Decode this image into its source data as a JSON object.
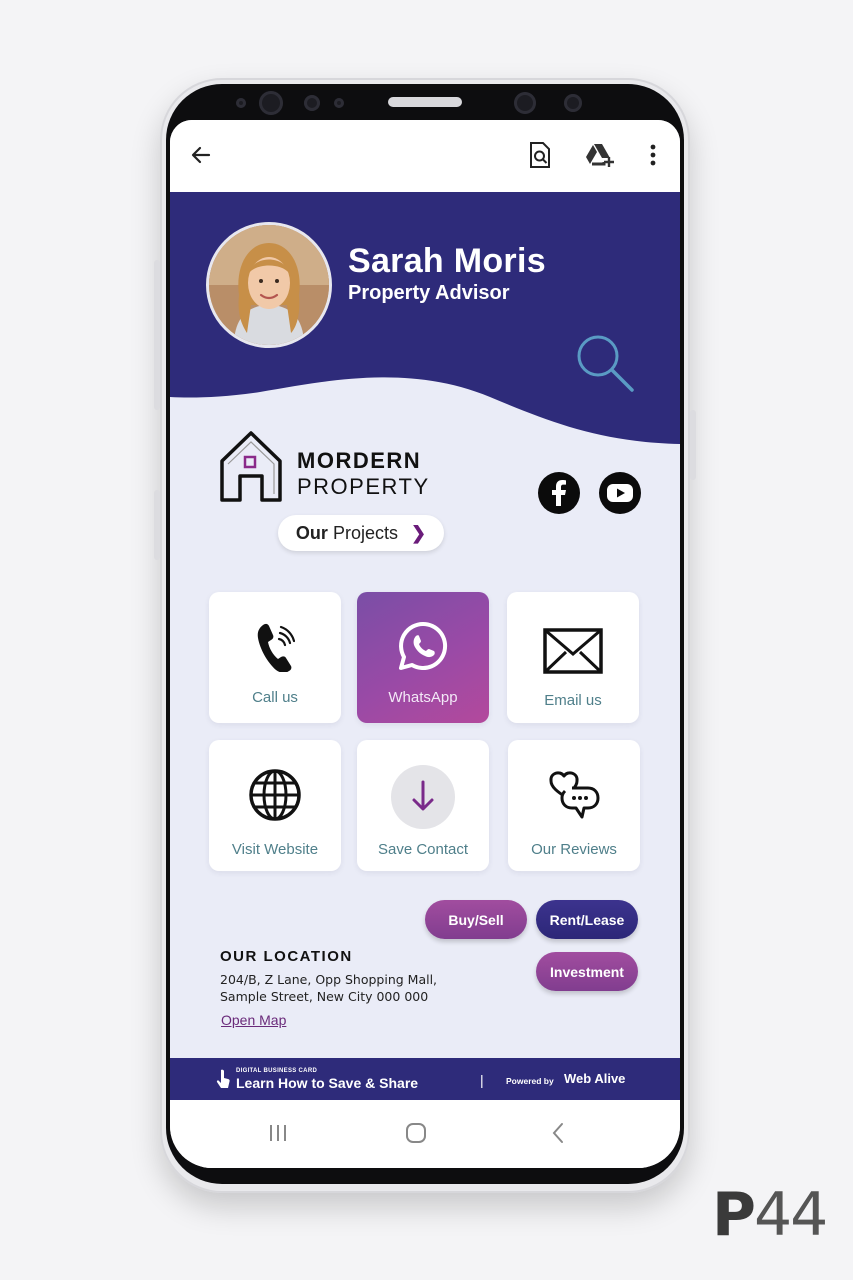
{
  "app_bar": {
    "back_icon": "arrow-left-icon",
    "search_doc_icon": "document-search-icon",
    "drive_icon": "drive-add-icon",
    "menu_icon": "more-vertical-icon"
  },
  "profile": {
    "name": "Sarah Moris",
    "title": "Property Advisor"
  },
  "brand": {
    "line1": "MORDERN",
    "line2": "PROPERTY",
    "projects_bold": "Our",
    "projects_rest": "Projects"
  },
  "social": [
    "facebook-icon",
    "youtube-icon"
  ],
  "actions": [
    {
      "label": "Call us",
      "icon": "phone-icon"
    },
    {
      "label": "WhatsApp",
      "icon": "whatsapp-icon"
    },
    {
      "label": "Email us",
      "icon": "envelope-icon"
    },
    {
      "label": "Visit Website",
      "icon": "globe-icon"
    },
    {
      "label": "Save Contact",
      "icon": "download-arrow-icon"
    },
    {
      "label": "Our Reviews",
      "icon": "chat-heart-icon"
    }
  ],
  "location": {
    "title": "OUR LOCATION",
    "line1": "204/B, Z Lane, Opp Shopping Mall,",
    "line2": "Sample Street, New City 000 000",
    "map_link": "Open Map"
  },
  "pills": {
    "buy_sell": "Buy/Sell",
    "rent_lease": "Rent/Lease",
    "investment": "Investment"
  },
  "footer": {
    "tiny": "DIGITAL BUSINESS CARD",
    "learn": "Learn How to Save & Share",
    "separator": "|",
    "powered_by": "Powered by",
    "brand": "Web Alive"
  },
  "nav": [
    "recent-apps-icon",
    "home-icon",
    "back-icon"
  ],
  "watermark": {
    "letter": "P",
    "number": "44"
  },
  "colors": {
    "header_navy": "#2e2b7a",
    "accent_purple": "#9a4aa6",
    "card_bg": "#eaecf7"
  }
}
